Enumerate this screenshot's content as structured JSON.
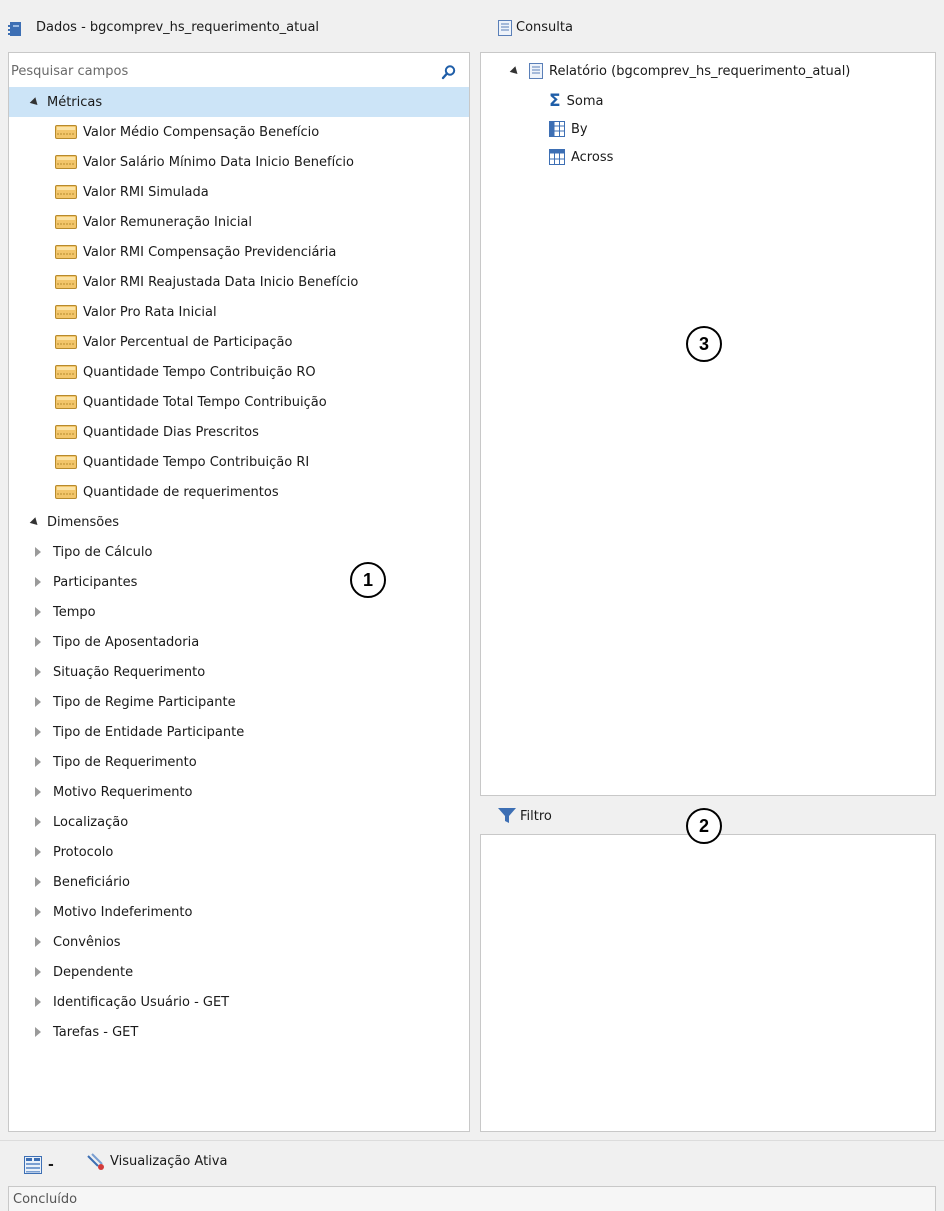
{
  "left_header": {
    "title": "Dados - bgcomprev_hs_requerimento_atual"
  },
  "search": {
    "placeholder": "Pesquisar campos"
  },
  "metrics_group": {
    "label": "Métricas"
  },
  "metrics": [
    "Valor Médio Compensação Benefício",
    "Valor Salário Mínimo Data Inicio Benefício",
    "Valor RMI Simulada",
    "Valor Remuneração Inicial",
    "Valor RMI Compensação Previdenciária",
    "Valor RMI Reajustada Data Inicio Benefício",
    "Valor Pro Rata Inicial",
    "Valor Percentual de Participação",
    "Quantidade Tempo Contribuição RO",
    "Quantidade Total Tempo Contribuição",
    "Quantidade Dias Prescritos",
    "Quantidade Tempo Contribuição RI",
    "Quantidade de requerimentos"
  ],
  "dimensions_group": {
    "label": "Dimensões"
  },
  "dimensions": [
    "Tipo de Cálculo",
    "Participantes",
    "Tempo",
    "Tipo de Aposentadoria",
    "Situação Requerimento",
    "Tipo de Regime Participante",
    "Tipo de Entidade Participante",
    "Tipo de Requerimento",
    "Motivo Requerimento",
    "Localização",
    "Protocolo",
    "Beneficiário",
    "Motivo Indeferimento",
    "Convênios",
    "Dependente",
    "Identificação Usuário - GET",
    "Tarefas - GET"
  ],
  "consulta": {
    "title": "Consulta",
    "report": "Relatório (bgcomprev_hs_requerimento_atual)",
    "items": [
      "Soma",
      "By",
      "Across"
    ]
  },
  "filtro": {
    "title": "Filtro"
  },
  "callouts": {
    "one": "1",
    "two": "2",
    "three": "3"
  },
  "toolbar": {
    "dash": "-",
    "active_view": "Visualização Ativa"
  },
  "status": {
    "text": "Concluído"
  },
  "colors": {
    "selected_row": "#cce4f7",
    "panel_border": "#c8c8c8",
    "background": "#f0f0f0"
  }
}
